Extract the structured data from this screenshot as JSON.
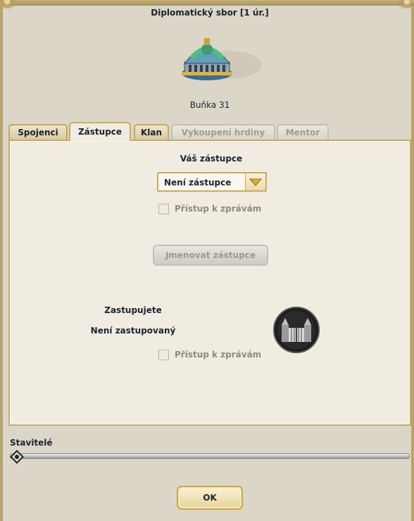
{
  "window": {
    "title": "Diplomatický sbor [1 úr.]",
    "subtitle": "Buňka 31"
  },
  "tabs": [
    {
      "label": "Spojenci",
      "state": "normal"
    },
    {
      "label": "Zástupce",
      "state": "active"
    },
    {
      "label": "Klan",
      "state": "normal"
    },
    {
      "label": "Vykoupení hrdiny",
      "state": "disabled"
    },
    {
      "label": "Mentor",
      "state": "disabled"
    }
  ],
  "deputy": {
    "heading": "Váš zástupce",
    "select_value": "Není zástupce",
    "message_access_label": "Přístup k zprávám",
    "message_access_checked": false,
    "appoint_button": "Jmenovat zástupce"
  },
  "represented": {
    "heading": "Zastupujete",
    "value": "Není zastupovaný",
    "message_access_label": "Přístup k zprávám",
    "message_access_checked": false
  },
  "builders": {
    "label": "Stavitelé",
    "value": 0
  },
  "footer": {
    "ok_label": "OK"
  },
  "icons": {
    "building": "embassy-building-icon",
    "gate": "gate-icon",
    "dropdown": "triangle-down-icon",
    "knob": "diamond-knob-icon"
  },
  "colors": {
    "panel_bg": "#f1ece1",
    "gold_border": "#c9ad62",
    "text": "#1c2330",
    "disabled_text": "#9d9992"
  }
}
